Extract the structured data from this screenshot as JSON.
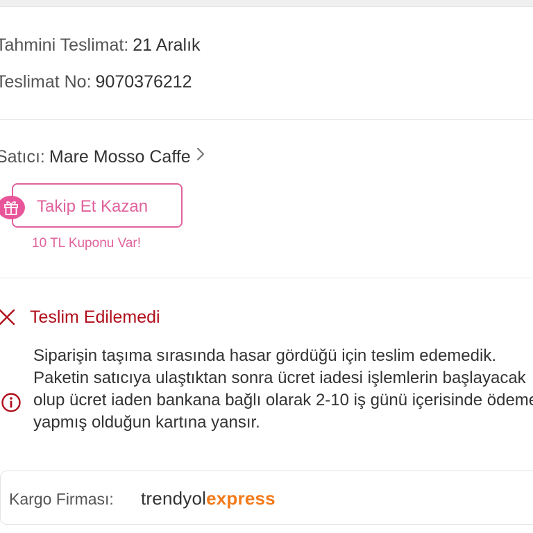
{
  "delivery": {
    "estimated_label": "Tahmini Teslimat:",
    "estimated_value": "21 Aralık",
    "number_label": "Teslimat No:",
    "number_value": "9070376212"
  },
  "seller": {
    "label": "Satıcı:",
    "name": "Mare Mosso Caffe"
  },
  "follow": {
    "button_label": "Takip Et Kazan",
    "coupon_text": "10 TL Kuponu Var!"
  },
  "status": {
    "title": "Teslim Edilemedi",
    "message": "Siparişin taşıma sırasında hasar gördüğü için teslim edemedik. Paketin satıcıya ulaştıktan sonra ücret iadesi işlemlerin başlayacak olup ücret iaden bankana bağlı olarak 2-10 iş günü içerisinde ödeme yapmış olduğun kartına yansır."
  },
  "cargo": {
    "label": "Kargo Firması:",
    "brand_part1": "trendyol",
    "brand_part2": "express"
  },
  "colors": {
    "accent_pink": "#e0629c",
    "error_red": "#b00e1b",
    "brand_orange": "#f27a1a"
  },
  "icons": [
    "chevron-right-icon",
    "gift-icon",
    "close-icon",
    "info-icon"
  ]
}
